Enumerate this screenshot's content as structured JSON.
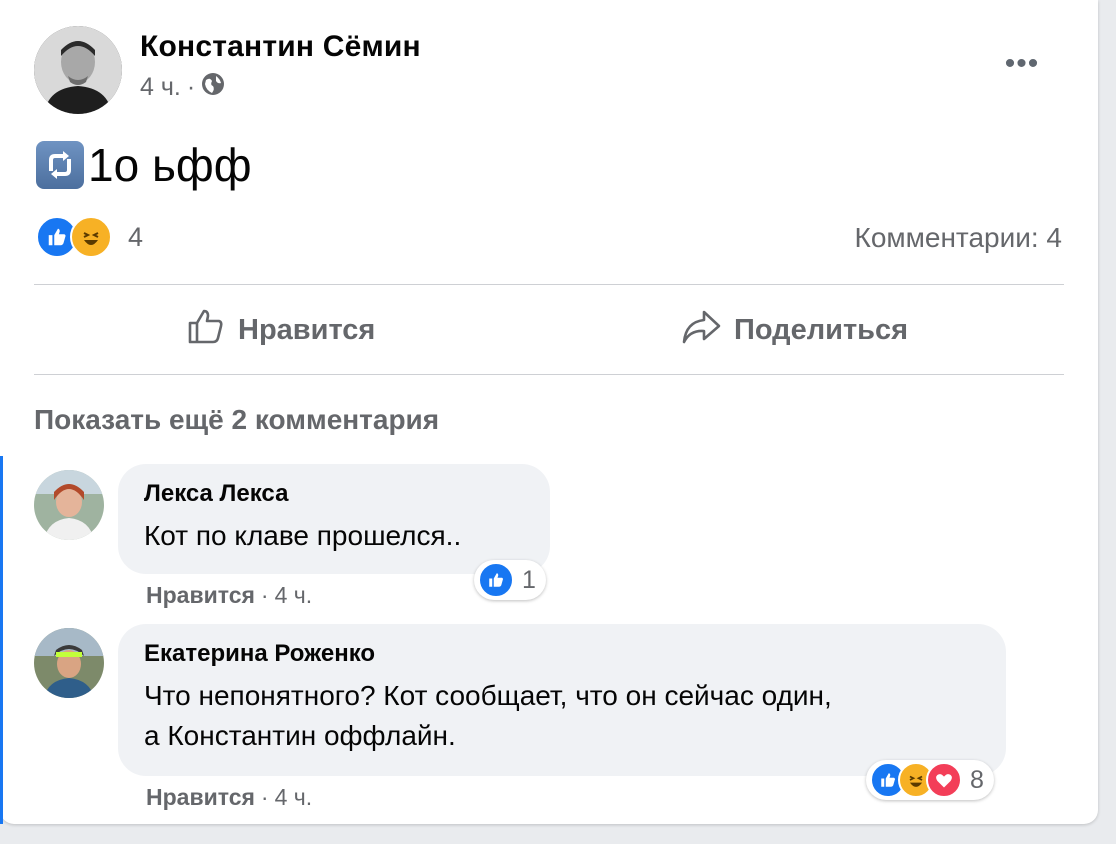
{
  "post": {
    "author": "Константин Сёмин",
    "time": "4 ч.",
    "separator": "·",
    "privacy_icon": "globe-icon",
    "text": "1о ьфф",
    "emoji_icon": "repeat-button-emoji",
    "reaction_count": "4",
    "comments_count": "Комментарии: 4"
  },
  "actions": {
    "like": "Нравится",
    "share": "Поделиться"
  },
  "show_more": "Показать ещё 2 комментария",
  "comments": [
    {
      "name": "Лекса Лекса",
      "text": "Кот по клаве прошелся..",
      "like": "Нравится",
      "separator": "·",
      "time": "4 ч.",
      "reaction_count": "1"
    },
    {
      "name": "Екатерина Роженко",
      "text_line1": "Что непонятного? Кот сообщает, что он сейчас один,",
      "text_line2": "а Константин оффлайн.",
      "like": "Нравится",
      "separator": "·",
      "time": "4 ч.",
      "reaction_count": "8"
    }
  ],
  "colors": {
    "accent": "#1877f2",
    "secondary_text": "#65676b",
    "bubble": "#f0f2f5"
  }
}
